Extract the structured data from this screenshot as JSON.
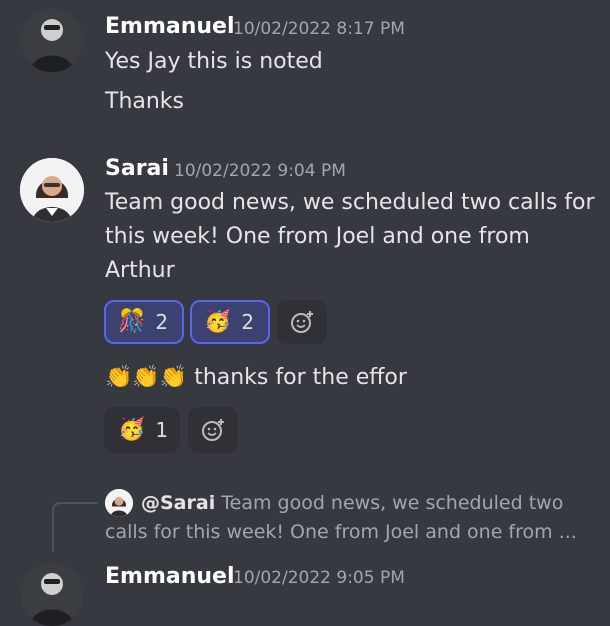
{
  "messages": [
    {
      "author": "Emmanuel",
      "timestamp": "10/02/2022 8:17 PM",
      "lines": [
        "Yes Jay this is noted",
        "Thanks"
      ]
    },
    {
      "author": "Sarai",
      "timestamp": "10/02/2022 9:04 PM",
      "lines": [
        "Team good news, we scheduled two calls for",
        "this week! One from Joel and one from",
        "Arthur"
      ],
      "reactions": [
        {
          "emoji": "🎊",
          "count": "2",
          "active": true
        },
        {
          "emoji": "🥳",
          "count": "2",
          "active": true
        }
      ],
      "followup": {
        "emojis": "👏👏👏",
        "text": "thanks for the effor",
        "reactions": [
          {
            "emoji": "🥳",
            "count": "1",
            "active": false
          }
        ]
      }
    },
    {
      "author": "Emmanuel",
      "timestamp": "10/02/2022 9:05 PM",
      "reply": {
        "mention": "@Sarai",
        "line1": "Team good news, we scheduled two",
        "line2": "calls for this week! One from Joel and one from ..."
      }
    }
  ],
  "colors": {
    "background": "#36393f",
    "reaction_active_border": "#5865f2",
    "reaction_active_bg": "#3c4270"
  },
  "icons": {
    "add_reaction": "add-reaction-icon"
  }
}
